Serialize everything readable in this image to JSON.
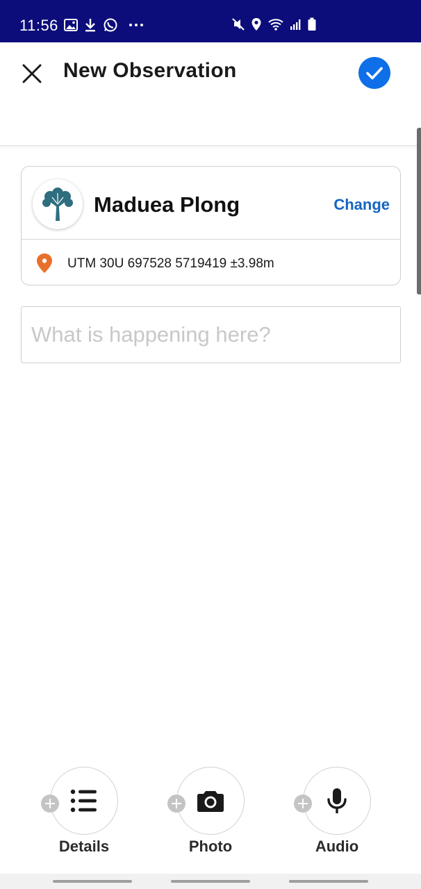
{
  "status_bar": {
    "time": "11:56",
    "left_icons": [
      "image-icon",
      "download-icon",
      "whatsapp-icon",
      "more-icon"
    ],
    "right_icons": [
      "mute-icon",
      "location-icon",
      "wifi-icon",
      "signal-icon",
      "battery-icon"
    ]
  },
  "header": {
    "title": "New Observation",
    "close_icon": "close-icon",
    "confirm_icon": "check-icon",
    "accent_color": "#0f6fe8"
  },
  "preset": {
    "name": "Maduea Plong",
    "icon": "tree-icon",
    "icon_color": "#2e6e7e",
    "change_label": "Change",
    "location_text": "UTM 30U 697528 5719419 ±3.98m",
    "location_icon_color": "#e8702a"
  },
  "observation": {
    "placeholder": "What is happening here?",
    "value": ""
  },
  "actions": [
    {
      "label": "Details",
      "icon": "list-icon"
    },
    {
      "label": "Photo",
      "icon": "camera-icon"
    },
    {
      "label": "Audio",
      "icon": "microphone-icon"
    }
  ]
}
